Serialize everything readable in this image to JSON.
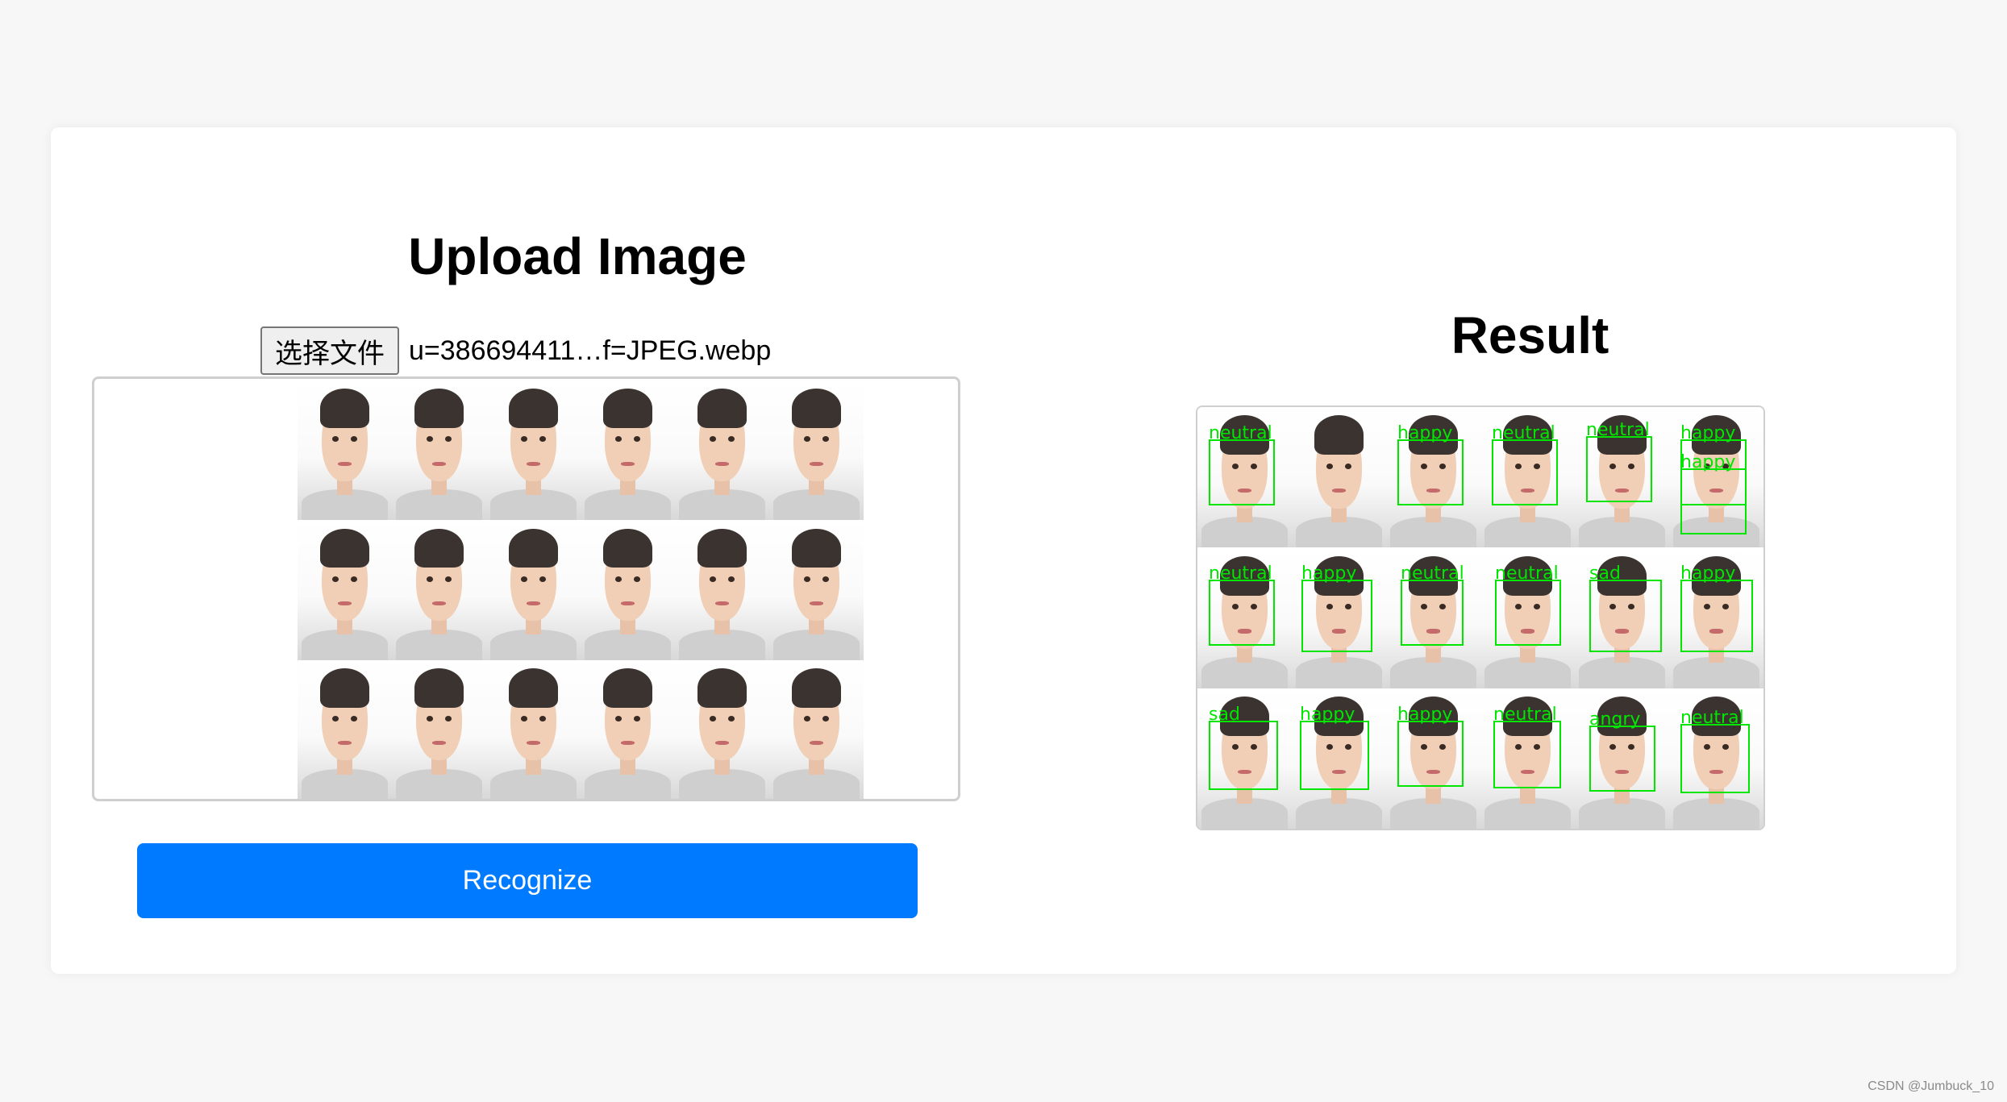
{
  "upload": {
    "title": "Upload Image",
    "choose_file_label": "选择文件",
    "file_name": "u=386694411…f=JPEG.webp"
  },
  "result": {
    "title": "Result",
    "detections": [
      {
        "cell": 0,
        "label": "neutral"
      },
      {
        "cell": 2,
        "label": "happy"
      },
      {
        "cell": 3,
        "label": "neutral"
      },
      {
        "cell": 4,
        "label": "neutral"
      },
      {
        "cell": 5,
        "label": "happy"
      },
      {
        "cell": 5,
        "label": "happy"
      },
      {
        "cell": 6,
        "label": "neutral"
      },
      {
        "cell": 7,
        "label": "happy"
      },
      {
        "cell": 8,
        "label": "neutral"
      },
      {
        "cell": 9,
        "label": "neutral"
      },
      {
        "cell": 10,
        "label": "sad"
      },
      {
        "cell": 11,
        "label": "happy"
      },
      {
        "cell": 12,
        "label": "sad"
      },
      {
        "cell": 13,
        "label": "happy"
      },
      {
        "cell": 14,
        "label": "happy"
      },
      {
        "cell": 15,
        "label": "neutral"
      },
      {
        "cell": 16,
        "label": "angry"
      },
      {
        "cell": 17,
        "label": "neutral"
      }
    ]
  },
  "actions": {
    "recognize_label": "Recognize"
  },
  "watermark": "CSDN @Jumbuck_10",
  "colors": {
    "accent": "#007bff",
    "detection": "#00e600",
    "background": "#f7f7f7"
  }
}
